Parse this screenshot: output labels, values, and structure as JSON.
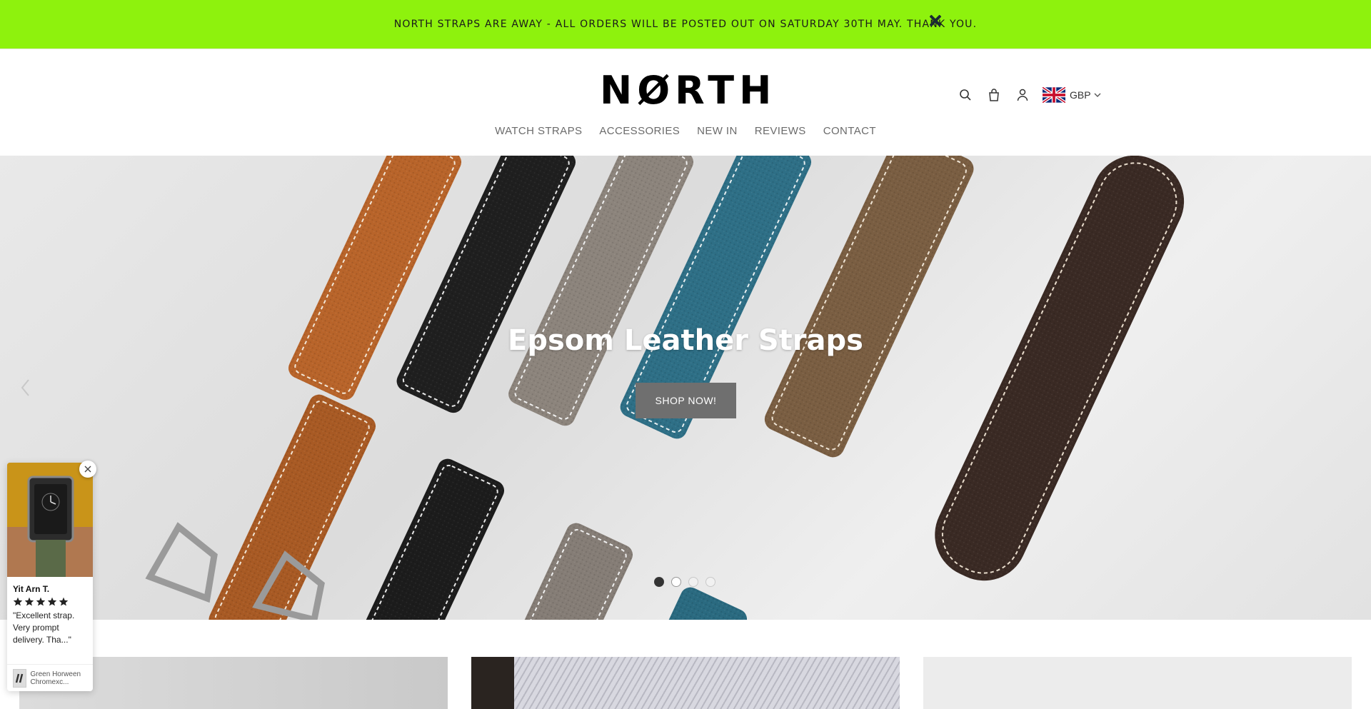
{
  "announcement": {
    "text": "NORTH STRAPS ARE AWAY - ALL ORDERS WILL BE POSTED OUT ON SATURDAY 30TH MAY. THANK YOU.",
    "close_icon": "close-icon",
    "bg_color": "#8ef20d"
  },
  "header": {
    "logo_text": "NØRTH",
    "tools": {
      "search_icon": "search-icon",
      "cart_icon": "bag-icon",
      "account_icon": "user-icon",
      "currency": "GBP",
      "flag_icon": "uk-flag-icon"
    },
    "nav": [
      {
        "label": "WATCH STRAPS"
      },
      {
        "label": "ACCESSORIES"
      },
      {
        "label": "NEW IN"
      },
      {
        "label": "REVIEWS"
      },
      {
        "label": "CONTACT"
      }
    ]
  },
  "hero": {
    "title": "Epsom Leather Straps",
    "button_label": "SHOP NOW!",
    "prev_icon": "chevron-left-icon",
    "slides_count": 4,
    "active_slide": 2
  },
  "review_popup": {
    "name": "Yit Arn T.",
    "rating": 5,
    "text": "\"Excellent strap. Very prompt delivery. Tha...\"",
    "product": "Green Horween Chromexc...",
    "close_icon": "close-icon"
  }
}
